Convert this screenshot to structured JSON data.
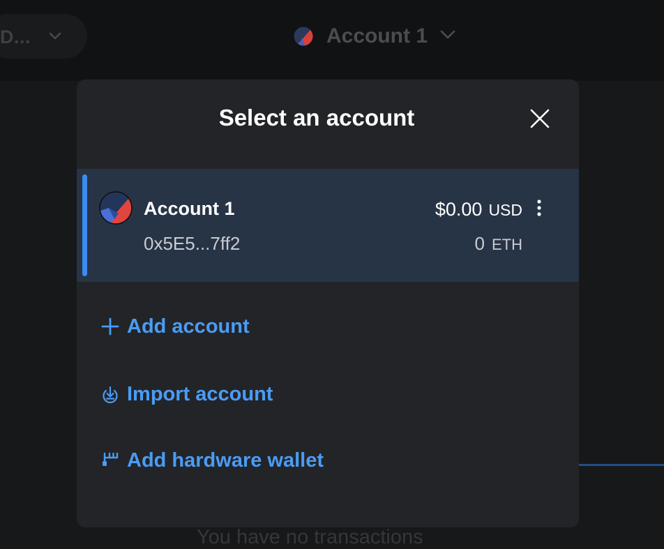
{
  "topbar": {
    "network_label": "D...",
    "account_name": "Account 1"
  },
  "background": {
    "no_transactions": "You have no transactions"
  },
  "modal": {
    "title": "Select an account",
    "accounts": [
      {
        "name": "Account 1",
        "address": "0x5E5...7ff2",
        "fiat_amount": "$0.00",
        "fiat_unit": "USD",
        "crypto_amount": "0",
        "crypto_unit": "ETH"
      }
    ],
    "actions": {
      "add_account": "Add account",
      "import_account": "Import account",
      "add_hardware_wallet": "Add hardware wallet"
    }
  },
  "colors": {
    "accent": "#4a9cf5",
    "selected_row": "#273446",
    "modal_bg": "#232427"
  },
  "icons": {
    "close": "close-icon",
    "more": "more-options-icon",
    "plus": "plus-icon",
    "import": "import-icon",
    "hardware": "hardware-wallet-icon",
    "chevron": "chevron-down-icon"
  }
}
